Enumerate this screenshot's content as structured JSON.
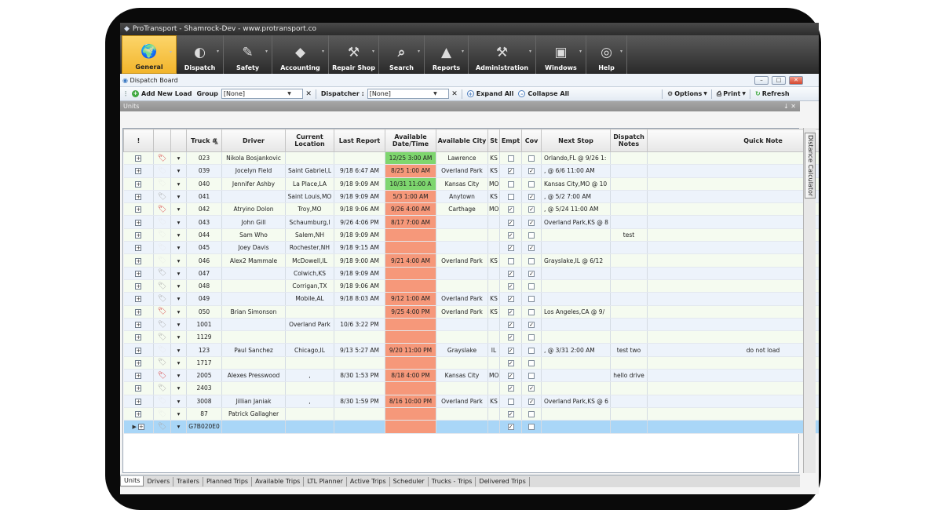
{
  "window": {
    "title": "ProTransport - Shamrock-Dev - www.protransport.co"
  },
  "ribbon": [
    {
      "label": "General",
      "icon": "globe-icon"
    },
    {
      "label": "Dispatch",
      "icon": "dispatch-icon"
    },
    {
      "label": "Safety",
      "icon": "safety-icon"
    },
    {
      "label": "Accounting",
      "icon": "accounting-icon"
    },
    {
      "label": "Repair Shop",
      "icon": "wrench-icon"
    },
    {
      "label": "Search",
      "icon": "search-icon"
    },
    {
      "label": "Reports",
      "icon": "reports-icon"
    },
    {
      "label": "Administration",
      "icon": "administration-icon"
    },
    {
      "label": "Windows",
      "icon": "windows-icon"
    },
    {
      "label": "Help",
      "icon": "help-icon"
    }
  ],
  "dispatch_board": {
    "title": "Dispatch Board"
  },
  "toolbar": {
    "add_new_load": "Add New Load",
    "group_label": "Group",
    "group_value": "[None]",
    "dispatcher_label": "Dispatcher :",
    "dispatcher_value": "[None]",
    "expand_all": "Expand All",
    "collapse_all": "Collapse All",
    "options": "Options",
    "print": "Print",
    "refresh": "Refresh"
  },
  "units_panel": {
    "title": "Units",
    "pin_close": "↓ ✕"
  },
  "sidebar": {
    "tab": "Distance Calculator"
  },
  "grid": {
    "columns": [
      "!",
      "",
      "",
      "Truck #",
      "Driver",
      "Current Location",
      "Last Report",
      "Available Date/Time",
      "Available City",
      "St",
      "Empt",
      "Cov",
      "Next Stop",
      "Dispatch Notes",
      "Quick Note"
    ],
    "rows": [
      {
        "tag": "red",
        "truck": "023",
        "driver": "Nikola Bosjankovic",
        "loc": "",
        "report": "",
        "avail": "12/25 3:00 AM",
        "avail_color": "g",
        "city": "Lawrence",
        "st": "KS",
        "empt": false,
        "cov": false,
        "next": "Orlando,FL @ 9/26 1:",
        "notes": "",
        "quick": ""
      },
      {
        "tag": "white",
        "truck": "039",
        "driver": "Jocelyn Field",
        "loc": "Saint Gabriel,L",
        "report": "9/18 6:47 AM",
        "avail": "8/25 1:00 AM",
        "avail_color": "o",
        "city": "Overland Park",
        "st": "KS",
        "empt": true,
        "cov": true,
        "next": ", @ 6/6 11:00 AM",
        "notes": "",
        "quick": ""
      },
      {
        "tag": "white",
        "truck": "040",
        "driver": "Jennifer  Ashby",
        "loc": "La Place,LA",
        "report": "9/18 9:09 AM",
        "avail": "10/31 11:00 A",
        "avail_color": "g",
        "city": "Kansas City",
        "st": "MO",
        "empt": false,
        "cov": false,
        "next": "Kansas City,MO @ 10",
        "notes": "",
        "quick": ""
      },
      {
        "tag": "grey",
        "truck": "041",
        "driver": "",
        "loc": "Saint Louis,MO",
        "report": "9/18 9:09 AM",
        "avail": "5/3 1:00 AM",
        "avail_color": "o",
        "city": "Anytown",
        "st": "KS",
        "empt": false,
        "cov": true,
        "next": ", @ 5/2 7:00 AM",
        "notes": "",
        "quick": ""
      },
      {
        "tag": "red",
        "truck": "042",
        "driver": "Atryino Dolon",
        "loc": "Troy,MO",
        "report": "9/18 9:06 AM",
        "avail": "9/26 4:00 AM",
        "avail_color": "o",
        "city": "Carthage",
        "st": "MO",
        "empt": true,
        "cov": true,
        "next": ", @ 5/24 11:00 AM",
        "notes": "",
        "quick": ""
      },
      {
        "tag": "white",
        "truck": "043",
        "driver": "John Gill",
        "loc": "Schaumburg,I",
        "report": "9/26 4:06 PM",
        "avail": "8/17 7:00 AM",
        "avail_color": "o",
        "city": "",
        "st": "",
        "empt": true,
        "cov": true,
        "next": "Overland Park,KS @ 8",
        "notes": "",
        "quick": ""
      },
      {
        "tag": "white",
        "truck": "044",
        "driver": "Sam Who",
        "loc": "Salem,NH",
        "report": "9/18 9:09 AM",
        "avail": "",
        "avail_color": "e",
        "city": "",
        "st": "",
        "empt": true,
        "cov": false,
        "next": "",
        "notes": "test",
        "quick": ""
      },
      {
        "tag": "white",
        "truck": "045",
        "driver": "Joey Davis",
        "loc": "Rochester,NH",
        "report": "9/18 9:15 AM",
        "avail": "",
        "avail_color": "e",
        "city": "",
        "st": "",
        "empt": true,
        "cov": true,
        "next": "",
        "notes": "",
        "quick": ""
      },
      {
        "tag": "white",
        "truck": "046",
        "driver": "Alex2 Mammale",
        "loc": "McDowell,IL",
        "report": "9/18 9:00 AM",
        "avail": "9/21 4:00 AM",
        "avail_color": "o",
        "city": "Overland Park",
        "st": "KS",
        "empt": false,
        "cov": false,
        "next": "Grayslake,IL @ 6/12",
        "notes": "",
        "quick": ""
      },
      {
        "tag": "grey",
        "truck": "047",
        "driver": "",
        "loc": "Colwich,KS",
        "report": "9/18 9:09 AM",
        "avail": "",
        "avail_color": "e",
        "city": "",
        "st": "",
        "empt": true,
        "cov": true,
        "next": "",
        "notes": "",
        "quick": ""
      },
      {
        "tag": "grey",
        "truck": "048",
        "driver": "",
        "loc": "Corrigan,TX",
        "report": "9/18 9:06 AM",
        "avail": "",
        "avail_color": "e",
        "city": "",
        "st": "",
        "empt": true,
        "cov": false,
        "next": "",
        "notes": "",
        "quick": ""
      },
      {
        "tag": "grey",
        "truck": "049",
        "driver": "",
        "loc": "Mobile,AL",
        "report": "9/18 8:03 AM",
        "avail": "9/12 1:00 AM",
        "avail_color": "o",
        "city": "Overland Park",
        "st": "KS",
        "empt": true,
        "cov": false,
        "next": "",
        "notes": "",
        "quick": ""
      },
      {
        "tag": "red",
        "truck": "050",
        "driver": "Brian Simonson",
        "loc": "",
        "report": "",
        "avail": "9/25 4:00 PM",
        "avail_color": "o",
        "city": "Overland Park",
        "st": "KS",
        "empt": true,
        "cov": false,
        "next": "Los Angeles,CA @ 9/",
        "notes": "",
        "quick": ""
      },
      {
        "tag": "grey",
        "truck": "1001",
        "driver": "",
        "loc": "Overland Park",
        "report": "10/6 3:22 PM",
        "avail": "",
        "avail_color": "e",
        "city": "",
        "st": "",
        "empt": true,
        "cov": true,
        "next": "",
        "notes": "",
        "quick": ""
      },
      {
        "tag": "grey",
        "truck": "1129",
        "driver": "",
        "loc": "",
        "report": "",
        "avail": "",
        "avail_color": "e",
        "city": "",
        "st": "",
        "empt": true,
        "cov": false,
        "next": "",
        "notes": "",
        "quick": ""
      },
      {
        "tag": "white",
        "truck": "123",
        "driver": "Paul Sanchez",
        "loc": "Chicago,IL",
        "report": "9/13 5:27 AM",
        "avail": "9/20 11:00 PM",
        "avail_color": "o",
        "city": "Grayslake",
        "st": "IL",
        "empt": true,
        "cov": false,
        "next": ", @ 3/31 2:00 AM",
        "notes": "test two",
        "quick": "do not load"
      },
      {
        "tag": "grey",
        "truck": "1717",
        "driver": "",
        "loc": "",
        "report": "",
        "avail": "",
        "avail_color": "e",
        "city": "",
        "st": "",
        "empt": true,
        "cov": false,
        "next": "",
        "notes": "",
        "quick": ""
      },
      {
        "tag": "red",
        "truck": "2005",
        "driver": "Alexes Presswood",
        "loc": ",",
        "report": "8/30 1:53 PM",
        "avail": "8/18 4:00 PM",
        "avail_color": "o",
        "city": "Kansas City",
        "st": "MO",
        "empt": true,
        "cov": false,
        "next": "",
        "notes": "hello drive",
        "quick": ""
      },
      {
        "tag": "grey",
        "truck": "2403",
        "driver": "",
        "loc": "",
        "report": "",
        "avail": "",
        "avail_color": "e",
        "city": "",
        "st": "",
        "empt": true,
        "cov": true,
        "next": "",
        "notes": "",
        "quick": ""
      },
      {
        "tag": "white",
        "truck": "3008",
        "driver": "Jillian Janiak",
        "loc": ",",
        "report": "8/30 1:59 PM",
        "avail": "8/16 10:00 PM",
        "avail_color": "o",
        "city": "Overland Park",
        "st": "KS",
        "empt": false,
        "cov": true,
        "next": "Overland Park,KS @ 6",
        "notes": "",
        "quick": ""
      },
      {
        "tag": "white",
        "truck": "87",
        "driver": "Patrick Gallagher",
        "loc": "",
        "report": "",
        "avail": "",
        "avail_color": "e",
        "city": "",
        "st": "",
        "empt": true,
        "cov": false,
        "next": "",
        "notes": "",
        "quick": ""
      },
      {
        "tag": "grey",
        "truck": "G7B020E0",
        "driver": "",
        "loc": "",
        "report": "",
        "avail": "",
        "avail_color": "e",
        "city": "",
        "st": "",
        "empt": true,
        "cov": false,
        "next": "",
        "notes": "",
        "quick": "",
        "selected": true
      }
    ]
  },
  "bottom_tabs": [
    "Units",
    "Drivers",
    "Trailers",
    "Planned Trips",
    "Available Trips",
    "LTL Planner",
    "Active Trips",
    "Scheduler",
    "Trucks - Trips",
    "Delivered Trips"
  ]
}
